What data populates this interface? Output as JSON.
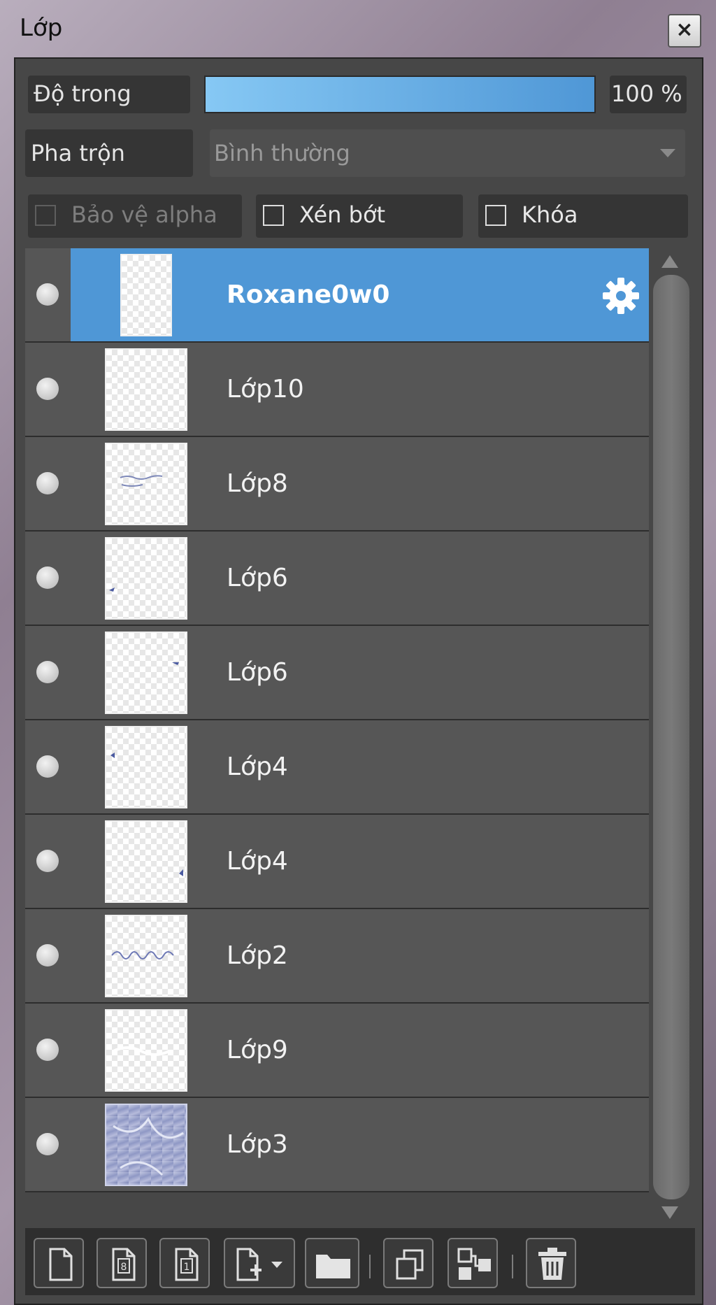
{
  "window": {
    "title": "Lớp",
    "close_label": "×"
  },
  "opacity": {
    "label": "Độ trong",
    "value": "100 %",
    "fill_fraction": 1.0
  },
  "blend": {
    "label": "Pha trộn",
    "selected": "Bình thường"
  },
  "checkboxes": {
    "protect_alpha": "Bảo vệ alpha",
    "clipping": "Xén bớt",
    "lock": "Khóa"
  },
  "layers": [
    {
      "name": "Roxane0w0",
      "selected": true
    },
    {
      "name": "Lớp10",
      "selected": false
    },
    {
      "name": "Lớp8",
      "selected": false
    },
    {
      "name": "Lớp6",
      "selected": false
    },
    {
      "name": "Lớp6",
      "selected": false
    },
    {
      "name": "Lớp4",
      "selected": false
    },
    {
      "name": "Lớp4",
      "selected": false
    },
    {
      "name": "Lớp2",
      "selected": false
    },
    {
      "name": "Lớp9",
      "selected": false
    },
    {
      "name": "Lớp3",
      "selected": false
    }
  ],
  "colors": {
    "panel_bg": "#474747",
    "selected_row": "#4f97d6",
    "opacity_fill": "#6fb6ea"
  },
  "toolbar_icons": [
    "new-layer-icon",
    "new-8bit-layer-icon",
    "new-1bit-layer-icon",
    "add-layer-dropdown-icon",
    "new-folder-icon",
    "duplicate-layer-icon",
    "merge-down-icon",
    "delete-layer-icon"
  ]
}
